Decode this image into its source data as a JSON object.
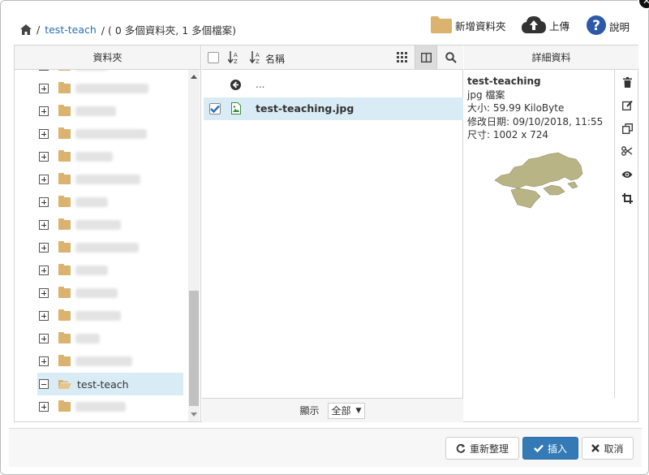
{
  "header": {
    "breadcrumb_sep": "/",
    "breadcrumb_current": "test-teach",
    "breadcrumb_info": "/ ( 0 多個資料夾, 1 多個檔案)",
    "new_folder_label": "新增資料夾",
    "upload_label": "上傳",
    "help_label": "說明"
  },
  "columns": {
    "folders": "資料夾",
    "name": "名稱",
    "details": "詳細資料"
  },
  "tree": {
    "selected_folder": "test-teach"
  },
  "files": {
    "parent_label": "...",
    "items": [
      {
        "name": "test-teaching.jpg",
        "checked": true
      }
    ],
    "show_label": "顯示",
    "filter_value": "全部"
  },
  "details": {
    "name": "test-teaching",
    "type": "jpg 檔案",
    "size": "大小: 59.99 KiloByte",
    "modified": "修改日期: 09/10/2018, 11:55",
    "dimensions": "尺寸: 1002 x 724"
  },
  "footer": {
    "refresh_label": "重新整理",
    "insert_label": "插入",
    "cancel_label": "取消"
  },
  "colors": {
    "accent": "#337ab7",
    "folder": "#dbb26e",
    "selected_row": "#d9ecf5",
    "link": "#2a6fb5"
  }
}
